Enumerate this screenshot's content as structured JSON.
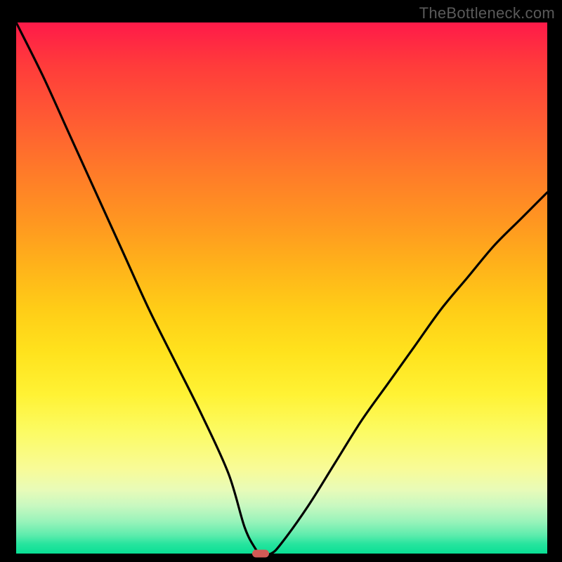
{
  "watermark": "TheBottleneck.com",
  "chart_data": {
    "type": "line",
    "title": "",
    "xlabel": "",
    "ylabel": "",
    "xlim": [
      0,
      100
    ],
    "ylim": [
      0,
      100
    ],
    "grid": false,
    "legend": false,
    "background_gradient": {
      "top": "#ff1a49",
      "bottom": "#09df95",
      "description": "vertical red→orange→yellow→green gradient"
    },
    "series": [
      {
        "name": "bottleneck-curve",
        "color": "#000000",
        "x": [
          0,
          5,
          10,
          15,
          20,
          25,
          30,
          35,
          40,
          43,
          45,
          46,
          48,
          50,
          55,
          60,
          65,
          70,
          75,
          80,
          85,
          90,
          95,
          100
        ],
        "y": [
          100,
          90,
          79,
          68,
          57,
          46,
          36,
          26,
          15,
          5,
          1,
          0,
          0,
          2,
          9,
          17,
          25,
          32,
          39,
          46,
          52,
          58,
          63,
          68
        ]
      }
    ],
    "marker": {
      "x": 46,
      "y": 0,
      "color": "#d25a56",
      "shape": "pill"
    }
  }
}
